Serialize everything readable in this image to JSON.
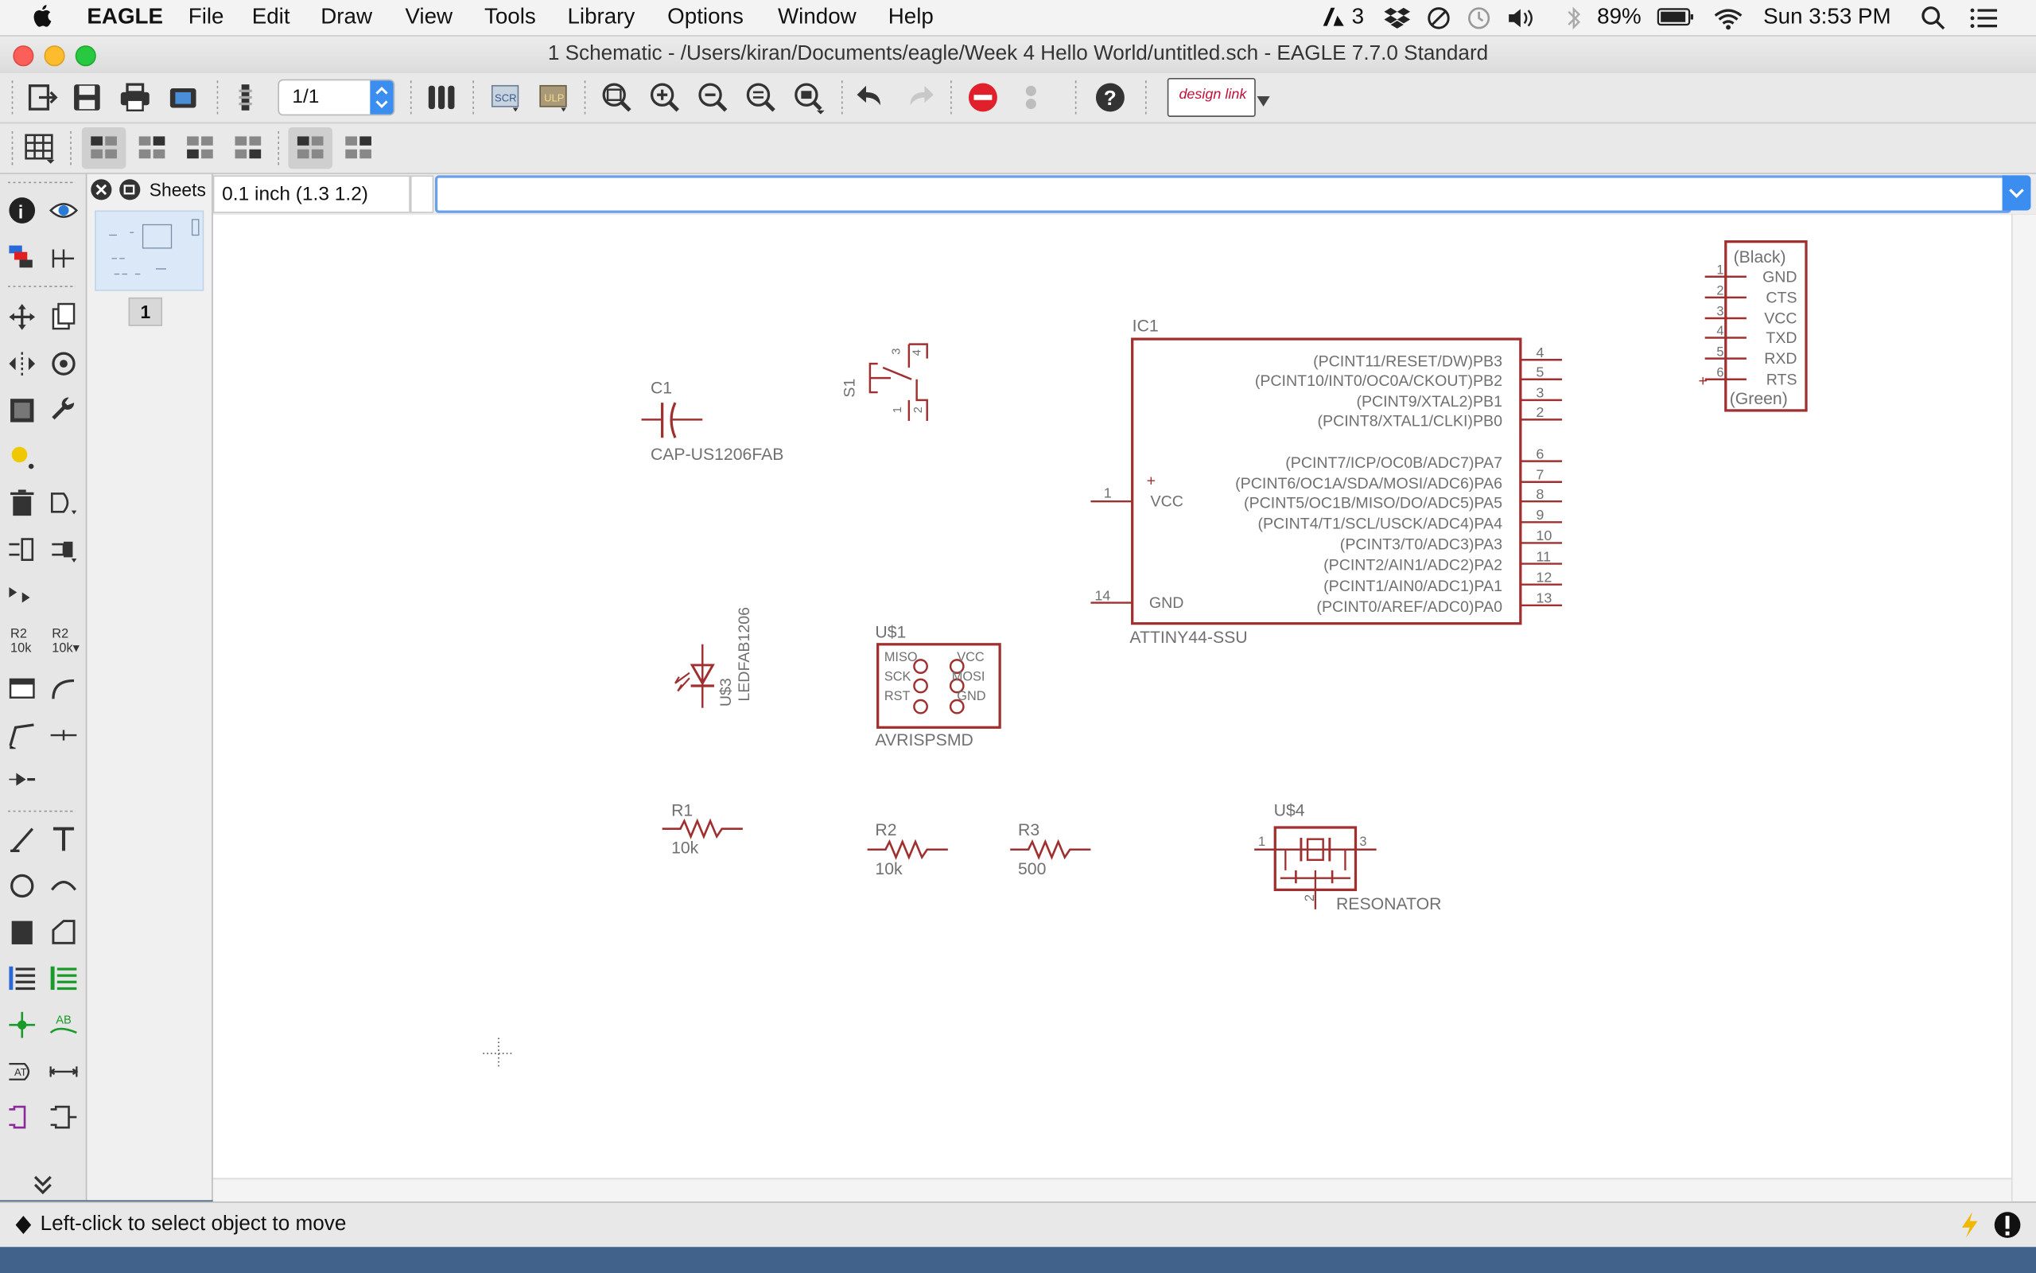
{
  "menubar": {
    "app": "EAGLE",
    "items": [
      "File",
      "Edit",
      "Draw",
      "View",
      "Tools",
      "Library",
      "Options",
      "Window",
      "Help"
    ],
    "adobe_count": "3",
    "battery": "89%",
    "clock": "Sun 3:53 PM"
  },
  "window": {
    "title": "1 Schematic - /Users/kiran/Documents/eagle/Week 4 Hello World/untitled.sch - EAGLE 7.7.0 Standard"
  },
  "toolbar": {
    "sheet_select": "1/1",
    "design_link": "design link"
  },
  "sheets_panel": {
    "label": "Sheets",
    "sheet_number": "1"
  },
  "grid_display": "0.1 inch (1.3 1.2)",
  "command_input": {
    "value": "",
    "placeholder": ""
  },
  "status": {
    "text": "Left-click to select object to move"
  },
  "schematic": {
    "c1": {
      "name": "C1",
      "value": "CAP-US1206FAB"
    },
    "s1": {
      "name": "S1",
      "pins": [
        "1",
        "2",
        "3",
        "4"
      ]
    },
    "ic1": {
      "name": "IC1",
      "value": "ATTINY44-SSU",
      "vcc": "VCC",
      "gnd": "GND",
      "vcc_pin": "1",
      "gnd_pin": "14",
      "plus": "+",
      "right_pins": [
        {
          "label": "(PCINT11/RESET/DW)PB3",
          "num": "4"
        },
        {
          "label": "(PCINT10/INT0/OC0A/CKOUT)PB2",
          "num": "5"
        },
        {
          "label": "(PCINT9/XTAL2)PB1",
          "num": "3"
        },
        {
          "label": "(PCINT8/XTAL1/CLKI)PB0",
          "num": "2"
        },
        {
          "label": "(PCINT7/ICP/OC0B/ADC7)PA7",
          "num": "6"
        },
        {
          "label": "(PCINT6/OC1A/SDA/MOSI/ADC6)PA6",
          "num": "7"
        },
        {
          "label": "(PCINT5/OC1B/MISO/DO/ADC5)PA5",
          "num": "8"
        },
        {
          "label": "(PCINT4/T1/SCL/USCK/ADC4)PA4",
          "num": "9"
        },
        {
          "label": "(PCINT3/T0/ADC3)PA3",
          "num": "10"
        },
        {
          "label": "(PCINT2/AIN1/ADC2)PA2",
          "num": "11"
        },
        {
          "label": "(PCINT1/AIN0/ADC1)PA1",
          "num": "12"
        },
        {
          "label": "(PCINT0/AREF/ADC0)PA0",
          "num": "13"
        }
      ]
    },
    "ftdi": {
      "top": "(Black)",
      "bottom": "(Green)",
      "plus": "+",
      "pins": [
        {
          "num": "1",
          "label": "GND"
        },
        {
          "num": "2",
          "label": "CTS"
        },
        {
          "num": "3",
          "label": "VCC"
        },
        {
          "num": "4",
          "label": "TXD"
        },
        {
          "num": "5",
          "label": "RXD"
        },
        {
          "num": "6",
          "label": "RTS"
        }
      ]
    },
    "u3": {
      "name": "U$3",
      "value": "LEDFAB1206"
    },
    "u1": {
      "name": "U$1",
      "value": "AVRISPSMD",
      "left": [
        "MISO",
        "SCK",
        "RST"
      ],
      "right": [
        "VCC",
        "MOSI",
        "GND"
      ]
    },
    "r1": {
      "name": "R1",
      "value": "10k"
    },
    "r2": {
      "name": "R2",
      "value": "10k"
    },
    "r3": {
      "name": "R3",
      "value": "500"
    },
    "u4": {
      "name": "U$4",
      "value": "RESONATOR",
      "pin1": "1",
      "pin2": "2",
      "pin3": "3"
    }
  },
  "colors": {
    "part": "#a03030",
    "label": "#707070",
    "canvas": "#ffffff"
  }
}
